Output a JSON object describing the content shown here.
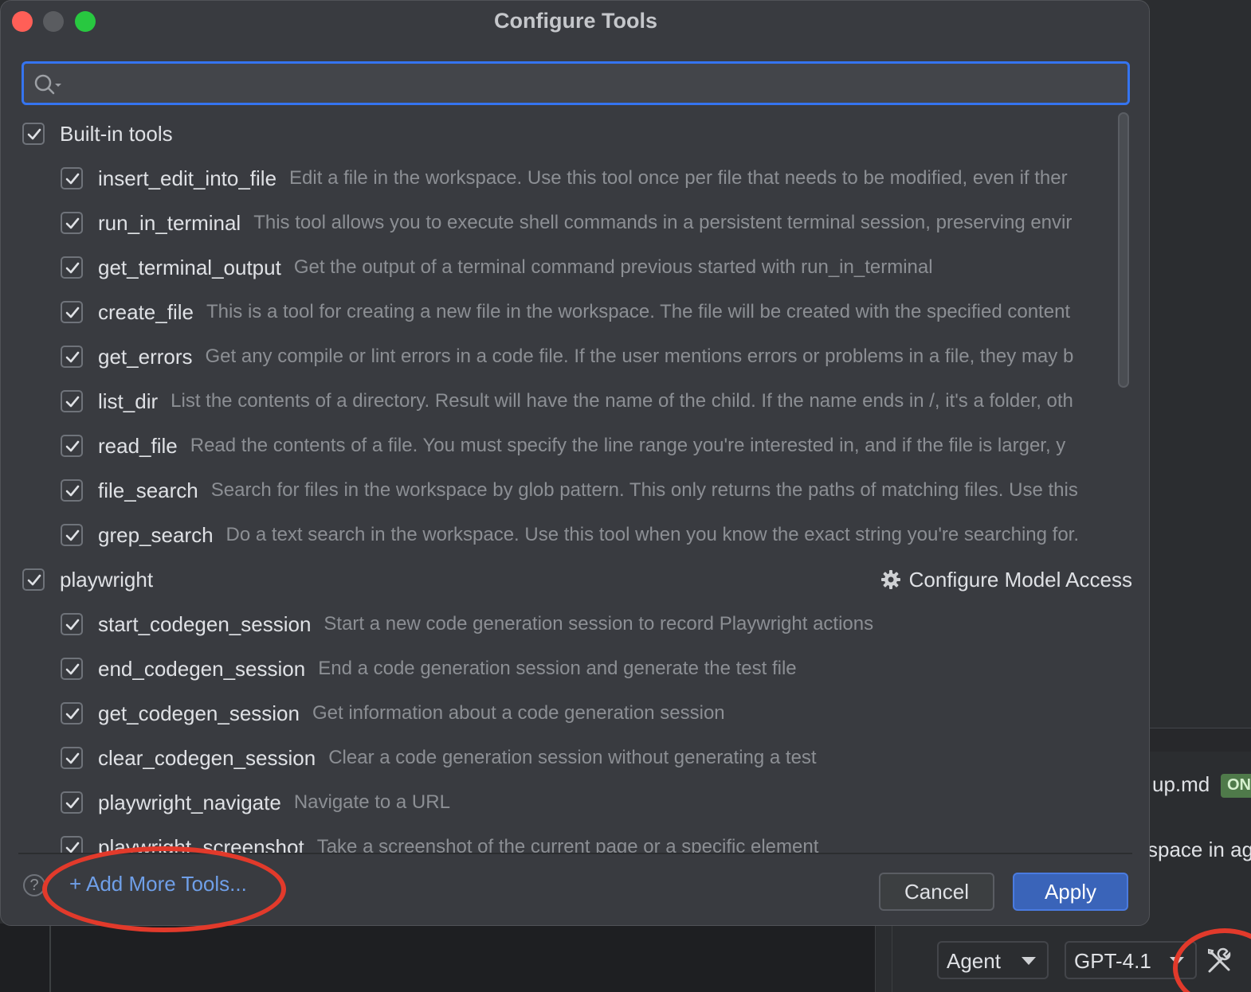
{
  "dialog": {
    "title": "Configure Tools",
    "search_placeholder": "",
    "groups": [
      {
        "name": "Built-in tools",
        "checked": true,
        "tools": [
          {
            "name": "insert_edit_into_file",
            "desc": "Edit a file in the workspace. Use this tool once per file that needs to be modified, even if ther"
          },
          {
            "name": "run_in_terminal",
            "desc": "This tool allows you to execute shell commands in a persistent terminal session, preserving envir"
          },
          {
            "name": "get_terminal_output",
            "desc": "Get the output of a terminal command previous started with run_in_terminal"
          },
          {
            "name": "create_file",
            "desc": "This is a tool for creating a new file in the workspace. The file will be created with the specified content"
          },
          {
            "name": "get_errors",
            "desc": "Get any compile or lint errors in a code file. If the user mentions errors or problems in a file, they may b"
          },
          {
            "name": "list_dir",
            "desc": "List the contents of a directory. Result will have the name of the child. If the name ends in /, it's a folder, oth"
          },
          {
            "name": "read_file",
            "desc": "Read the contents of a file.  You must specify the line range you're interested in, and if the file is larger, y"
          },
          {
            "name": "file_search",
            "desc": "Search for files in the workspace by glob pattern. This only returns the paths of matching files. Use this"
          },
          {
            "name": "grep_search",
            "desc": "Do a text search in the workspace. Use this tool when you know the exact string you're searching for."
          }
        ]
      },
      {
        "name": "playwright",
        "checked": true,
        "configure_label": "Configure Model Access",
        "tools": [
          {
            "name": "start_codegen_session",
            "desc": "Start a new code generation session to record Playwright actions"
          },
          {
            "name": "end_codegen_session",
            "desc": "End a code generation session and generate the test file"
          },
          {
            "name": "get_codegen_session",
            "desc": "Get information about a code generation session"
          },
          {
            "name": "clear_codegen_session",
            "desc": "Clear a code generation session without generating a test"
          },
          {
            "name": "playwright_navigate",
            "desc": "Navigate to a URL"
          },
          {
            "name": "playwright_screenshot",
            "desc": "Take a screenshot of the current page or a specific element"
          }
        ]
      }
    ],
    "help_label": "?",
    "add_more_label": "+ Add More Tools...",
    "cancel_label": "Cancel",
    "apply_label": "Apply"
  },
  "background": {
    "file_label": "up.md",
    "status_badge": "ON",
    "text_fragment": "space in ag",
    "mode_dropdown": "Agent",
    "model_dropdown": "GPT-4.1"
  },
  "colors": {
    "accent": "#3574f0",
    "link": "#6f9fe8",
    "highlight_circle": "#e23a2b",
    "dialog_bg": "#393b40"
  }
}
